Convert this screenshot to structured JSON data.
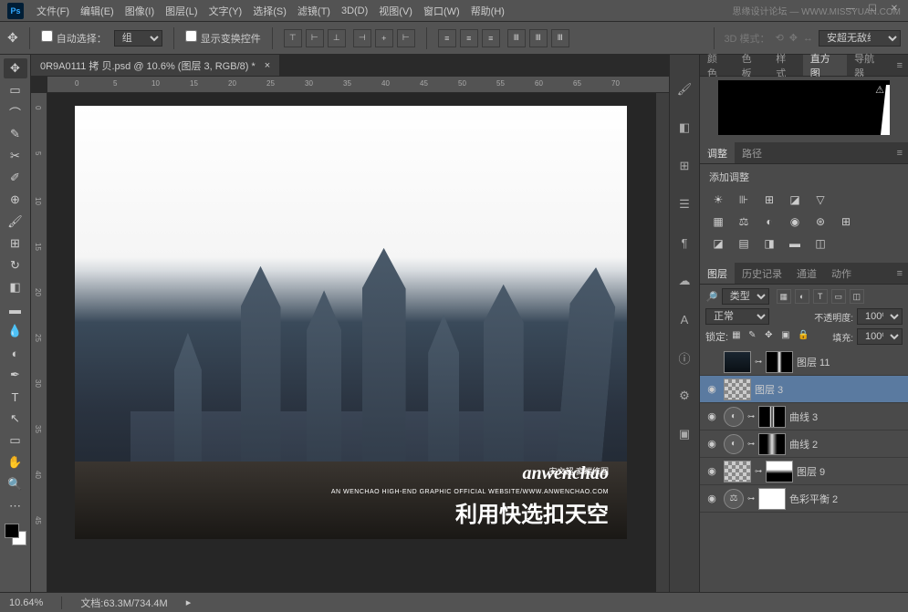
{
  "app": {
    "logo": "Ps"
  },
  "watermark": "思缘设计论坛 — WWW.MISSYUAN.COM",
  "menu": [
    "文件(F)",
    "编辑(E)",
    "图像(I)",
    "图层(L)",
    "文字(Y)",
    "选择(S)",
    "滤镜(T)",
    "3D(D)",
    "视图(V)",
    "窗口(W)",
    "帮助(H)"
  ],
  "options": {
    "auto_select": "自动选择：",
    "group": "组",
    "show_transform": "显示变换控件",
    "mode3d_label": "3D 模式：",
    "mode3d_select": "安超无敌组"
  },
  "document": {
    "tab_title": "0R9A0111 拷 贝.psd @ 10.6% (图层 3, RGB/8) *"
  },
  "ruler_h": [
    "0",
    "5",
    "10",
    "15",
    "20",
    "25",
    "30",
    "35",
    "40",
    "45",
    "50",
    "55",
    "60",
    "65",
    "70"
  ],
  "ruler_v": [
    "0",
    "5",
    "10",
    "15",
    "20",
    "25",
    "30",
    "35",
    "40",
    "45"
  ],
  "canvas": {
    "brand": "anwenchao",
    "brand_cn": "安文超 高端修图",
    "brand_url": "AN WENCHAO HIGH-END GRAPHIC OFFICIAL WEBSITE/WWW.ANWENCHAO.COM",
    "headline": "利用快选扣天空"
  },
  "panels": {
    "histogram_tabs": [
      "颜色",
      "色板",
      "样式",
      "直方图",
      "导航器"
    ],
    "adjust_tabs": [
      "调整",
      "路径"
    ],
    "adjust_title": "添加调整",
    "layers_tabs": [
      "图层",
      "历史记录",
      "通道",
      "动作"
    ],
    "filter_label": "类型",
    "blend_mode": "正常",
    "opacity_label": "不透明度:",
    "opacity_value": "100%",
    "lock_label": "锁定:",
    "fill_label": "填充:",
    "fill_value": "100%",
    "layers": [
      {
        "eye": "",
        "name": "图层 11",
        "thumb": "dark",
        "mask": true
      },
      {
        "eye": "◉",
        "name": "图层 3",
        "thumb": "checker",
        "selected": true
      },
      {
        "eye": "◉",
        "name": "曲线 3",
        "thumb": "adj",
        "mask": true
      },
      {
        "eye": "◉",
        "name": "曲线 2",
        "thumb": "adj",
        "mask": true
      },
      {
        "eye": "◉",
        "name": "图层 9",
        "thumb": "checker",
        "mask": true
      },
      {
        "eye": "◉",
        "name": "色彩平衡 2",
        "thumb": "adj",
        "mask": true
      }
    ]
  },
  "status": {
    "zoom": "10.64%",
    "doc_label": "文档:",
    "doc_size": "63.3M/734.4M"
  }
}
